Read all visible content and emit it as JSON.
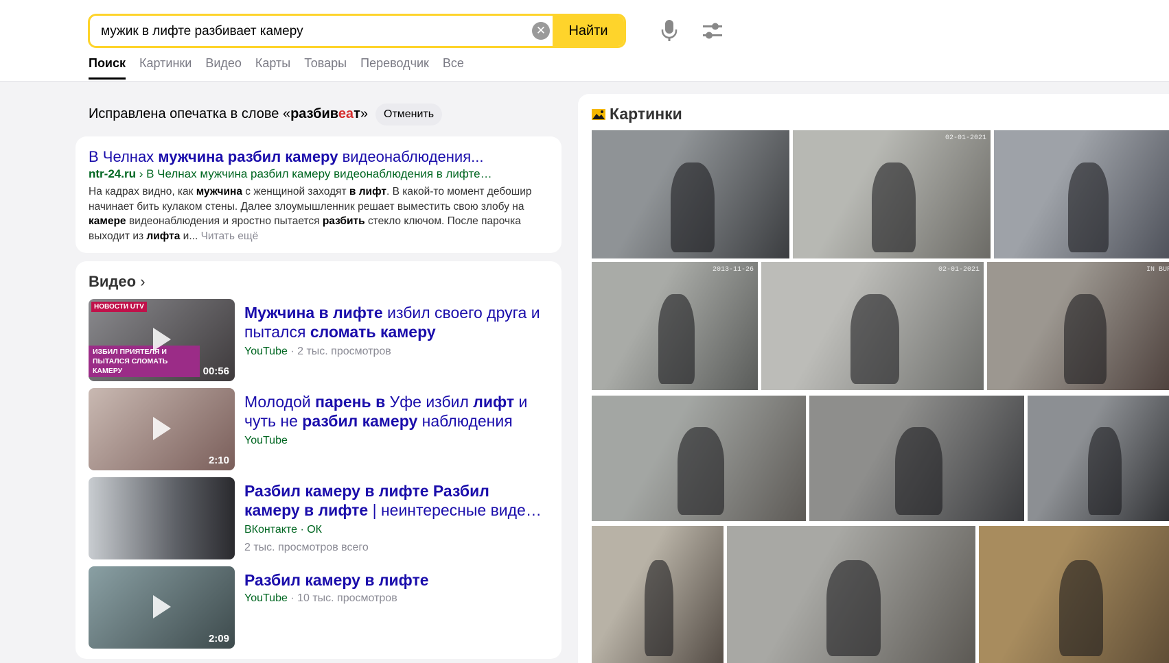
{
  "search": {
    "query": "мужик в лифте разбивает камеру",
    "find_label": "Найти",
    "clear_glyph": "✕"
  },
  "nav": {
    "tabs": [
      "Поиск",
      "Картинки",
      "Видео",
      "Карты",
      "Товары",
      "Переводчик",
      "Все"
    ],
    "active": "Поиск"
  },
  "typo": {
    "prefix": "Исправлена опечатка в слове «",
    "word_a": "разбив",
    "word_b": "еа",
    "word_c": "т",
    "suffix": "»",
    "cancel_label": "Отменить"
  },
  "result": {
    "title_a": "В Челнах ",
    "title_b": "мужчина разбил камеру",
    "title_c": " видеонаблюдения...",
    "url_domain": "ntr-24.ru",
    "url_crumb": " › В Челнах мужчина разбил камеру видеонаблюдения в лифте…",
    "snippet_1": "На кадрах видно, как ",
    "snippet_2": "мужчина",
    "snippet_3": " с женщиной заходят ",
    "snippet_4": "в лифт",
    "snippet_5": ". В какой-то момент дебошир начинает бить кулаком стены. Далее злоумышленник решает выместить свою злобу на ",
    "snippet_6": "камере",
    "snippet_7": " видеонаблюдения и яростно пытается ",
    "snippet_8": "разбить",
    "snippet_9": " стекло ключом. После парочка выходит из ",
    "snippet_10": "лифта",
    "snippet_11": " и... ",
    "read_more": "Читать ещё"
  },
  "videos": {
    "heading": "Видео",
    "chevron": "›",
    "items": [
      {
        "title_parts": [
          {
            "t": "Мужчина в лифте",
            "b": true
          },
          {
            "t": " избил своего друга и пытался ",
            "b": false
          },
          {
            "t": "сломать камеру",
            "b": true
          }
        ],
        "source": "YouTube",
        "meta": " · 2 тыс. просмотров",
        "duration": "00:56",
        "badge_top": "НОВОСТИ UTV",
        "badge_bottom": "ИЗБИЛ ПРИЯТЕЛЯ И ПЫТАЛСЯ СЛОМАТЬ КАМЕРУ"
      },
      {
        "title_parts": [
          {
            "t": "Молодой ",
            "b": false
          },
          {
            "t": "парень в",
            "b": true
          },
          {
            "t": " Уфе избил ",
            "b": false
          },
          {
            "t": "лифт",
            "b": true
          },
          {
            "t": " и чуть не ",
            "b": false
          },
          {
            "t": "разбил камеру",
            "b": true
          },
          {
            "t": " наблюдения",
            "b": false
          }
        ],
        "source": "YouTube",
        "meta": "",
        "duration": "2:10"
      },
      {
        "title_parts": [
          {
            "t": "Разбил камеру в лифте Разбил камеру в лифте",
            "b": true
          },
          {
            "t": " | неинтересные виде…",
            "b": false
          }
        ],
        "source": "ВКонтакте · ОК",
        "meta": "",
        "meta2": "2 тыс. просмотров всего",
        "duration": ""
      },
      {
        "title_parts": [
          {
            "t": "Разбил камеру в лифте",
            "b": true
          }
        ],
        "source": "YouTube",
        "meta": " · 10 тыс. просмотров",
        "duration": "2:09"
      }
    ]
  },
  "images": {
    "heading": "Картинки",
    "tiles": [
      {
        "tone": [
          "#8f9396",
          "#3b3d40"
        ],
        "stamp": ""
      },
      {
        "tone": [
          "#b7b8b3",
          "#6c6b66"
        ],
        "stamp": "02-01-2021"
      },
      {
        "tone": [
          "#9ea2a8",
          "#4a4d56"
        ],
        "stamp": ""
      },
      {
        "tone": [
          "#a9aba7",
          "#5a5c5a"
        ],
        "stamp": "2013-11-26"
      },
      {
        "tone": [
          "#bcbcb8",
          "#6e6f6c"
        ],
        "stamp": "02-01-2021"
      },
      {
        "tone": [
          "#9c9790",
          "#4a3d39"
        ],
        "stamp": "IN BURG"
      },
      {
        "tone": [
          "#a3a6a3",
          "#5d5a56"
        ],
        "stamp": ""
      },
      {
        "tone": [
          "#8e8e8c",
          "#3a3b3e"
        ],
        "stamp": ""
      },
      {
        "tone": [
          "#8c8f93",
          "#2c2d30"
        ],
        "stamp": ""
      },
      {
        "tone": [
          "#b8b2a6",
          "#544c45"
        ],
        "stamp": ""
      },
      {
        "tone": [
          "#a8a8a4",
          "#5c5954"
        ],
        "stamp": ""
      },
      {
        "tone": [
          "#a88c5e",
          "#5b4a34"
        ],
        "stamp": ""
      }
    ]
  },
  "colors": {
    "accent": "#fed42b",
    "link": "#1a0dab",
    "url": "#006621",
    "muted": "#8a8a94"
  }
}
